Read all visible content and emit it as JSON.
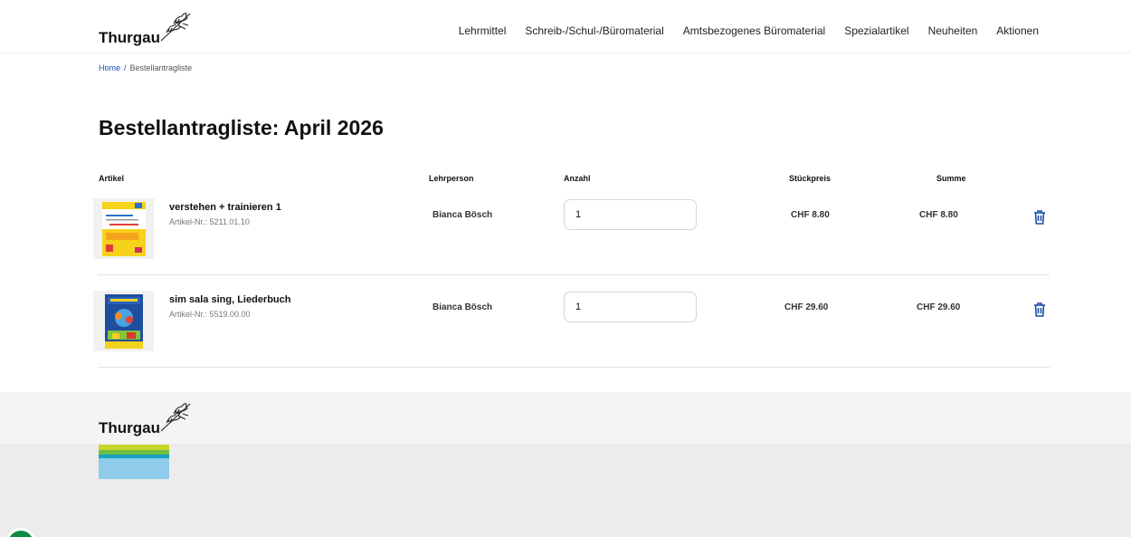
{
  "header": {
    "logo_text": "Thurgau",
    "nav": [
      "Lehrmittel",
      "Schreib-/Schul-/Büromaterial",
      "Amtsbezogenes Büromaterial",
      "Spezialartikel",
      "Neuheiten",
      "Aktionen"
    ]
  },
  "breadcrumb": {
    "home": "Home",
    "separator": "/",
    "current": "Bestellantragliste"
  },
  "page": {
    "title": "Bestellantragliste: April 2026"
  },
  "table": {
    "headers": {
      "artikel": "Artikel",
      "lehrperson": "Lehrperson",
      "anzahl": "Anzahl",
      "stueckpreis": "Stückpreis",
      "summe": "Summe"
    },
    "rows": [
      {
        "name": "verstehen + trainieren 1",
        "nr": "Artikel-Nr.: 5211.01.10",
        "teacher": "Bianca Bösch",
        "qty": "1",
        "unit_price": "CHF 8.80",
        "sum": "CHF 8.80",
        "thumb_icon": "book-cover-verstehen-trainieren",
        "delete_icon": "trash-icon"
      },
      {
        "name": "sim sala sing, Liederbuch",
        "nr": "Artikel-Nr.: 5519.00.00",
        "teacher": "Bianca Bösch",
        "qty": "1",
        "unit_price": "CHF 29.60",
        "sum": "CHF 29.60",
        "thumb_icon": "book-cover-sim-sala-sing",
        "delete_icon": "trash-icon"
      }
    ]
  },
  "footer": {
    "logo_text": "Thurgau",
    "stripe_colors": [
      "#c7d62a",
      "#6fbf44",
      "#19a3c4",
      "#8fcbea"
    ]
  },
  "colors": {
    "accent": "#1c4fa8",
    "help_button": "#0d8b46"
  }
}
